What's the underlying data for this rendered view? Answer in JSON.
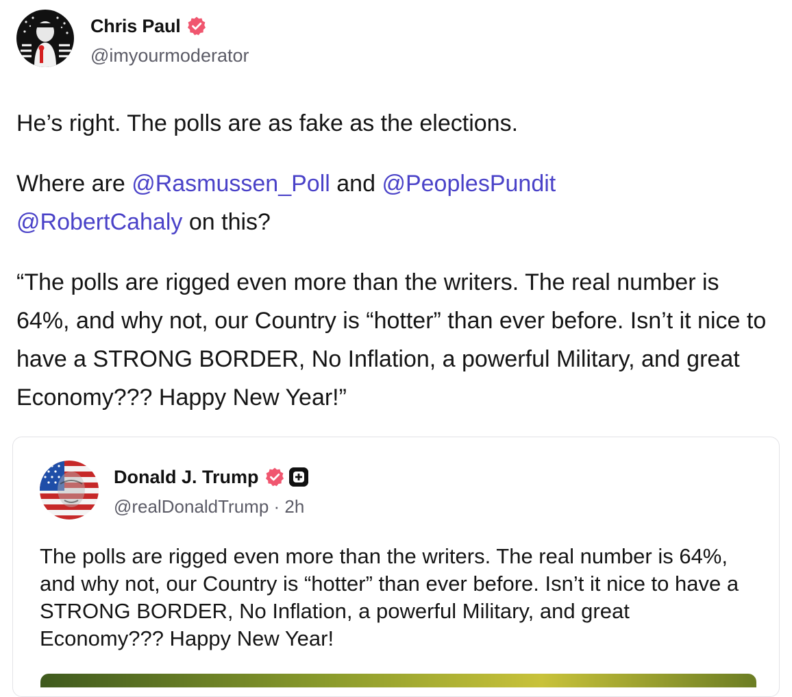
{
  "post": {
    "author_name": "Chris Paul",
    "handle": "@imyourmoderator",
    "paragraphs": {
      "p1": "He’s right. The polls are as fake as the elections.",
      "p2_prefix": "Where are ",
      "p2_mention1": "@Rasmussen_Poll",
      "p2_and": " and ",
      "p2_mention2": "@PeoplesPundit",
      "p2_mention3": "@RobertCahaly",
      "p2_suffix": " on this?",
      "p3": "“The polls are rigged even more than the writers. The real number is 64%, and why not, our Country is “hotter” than ever before. Isn’t it nice to have a STRONG BORDER, No Inflation, a powerful Military, and great Economy??? Happy New Year!”"
    }
  },
  "quoted_post": {
    "author_name": "Donald J. Trump",
    "handle": "@realDonaldTrump",
    "separator": " · ",
    "time": "2h",
    "body": "The polls are rigged even more than the writers. The real number is 64%, and why not, our Country is “hotter” than ever before. Isn’t it nice to have a STRONG BORDER, No Inflation, a powerful Military, and great Economy??? Happy New Year!"
  },
  "colors": {
    "mention": "#4a42c8",
    "verified_badge": "#f0566f",
    "secondary_text": "#5b5b66",
    "card_border": "#e2e2e6"
  },
  "icons": {
    "verified": "verified-badge-icon",
    "plus": "plus-badge-icon"
  }
}
